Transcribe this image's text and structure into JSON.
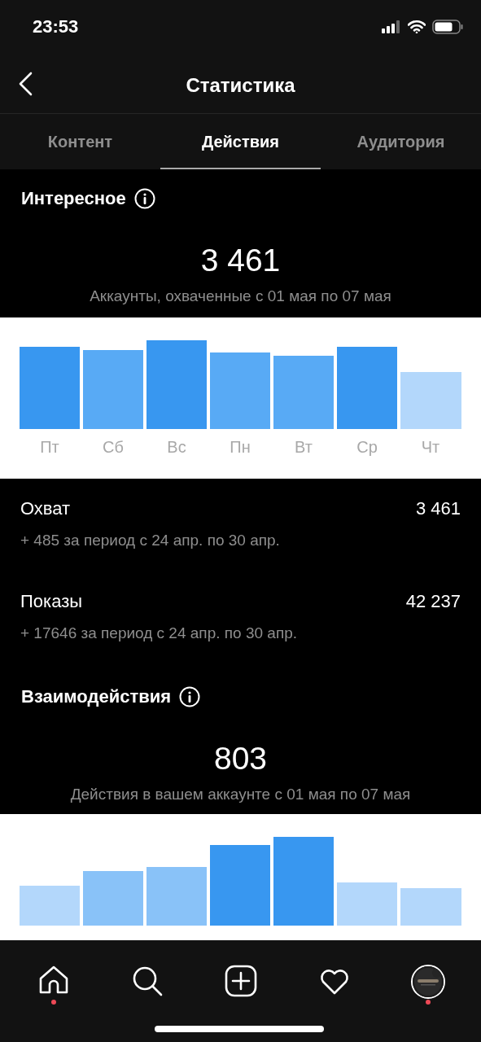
{
  "status_bar": {
    "time": "23:53"
  },
  "header": {
    "title": "Статистика"
  },
  "tabs": [
    {
      "label": "Контент",
      "selected": false
    },
    {
      "label": "Действия",
      "selected": true
    },
    {
      "label": "Аудитория",
      "selected": false
    }
  ],
  "discovery": {
    "title": "Интересное",
    "total": "3 461",
    "caption": "Аккаунты, охваченные с 01 мая по 07 мая",
    "days": [
      "Пт",
      "Сб",
      "Вс",
      "Пн",
      "Вт",
      "Ср",
      "Чт"
    ]
  },
  "metrics": [
    {
      "label": "Охват",
      "value": "3 461",
      "change": "+ 485 за период с 24 апр. по 30 апр."
    },
    {
      "label": "Показы",
      "value": "42 237",
      "change": "+ 17646 за период с 24 апр. по 30 апр."
    }
  ],
  "interactions": {
    "title": "Взаимодействия",
    "total": "803",
    "caption": "Действия в вашем аккаунте с 01 мая по 07 мая"
  },
  "nav": [
    {
      "kind": "home",
      "notification_dot": true
    },
    {
      "kind": "search",
      "notification_dot": false
    },
    {
      "kind": "add",
      "notification_dot": false
    },
    {
      "kind": "heart",
      "notification_dot": false
    },
    {
      "kind": "profile",
      "notification_dot": true
    }
  ]
}
